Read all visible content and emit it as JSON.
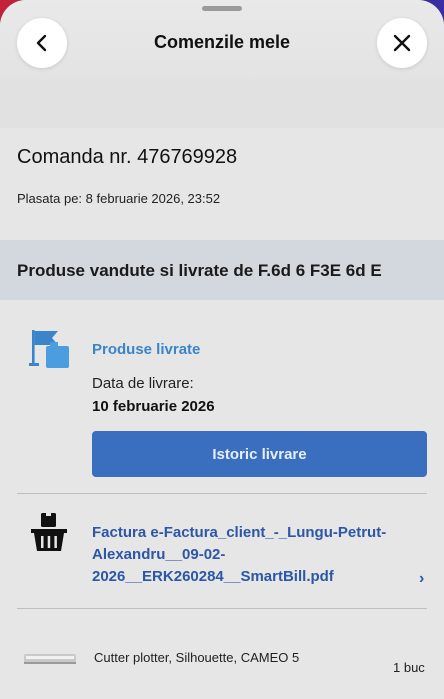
{
  "header": {
    "title": "Comenzile mele",
    "back_icon": "chevron-left-icon",
    "close_icon": "close-icon"
  },
  "order": {
    "number_text": "Comanda nr. 476769928",
    "placed_text": "Plasata pe: 8 februarie 2026, 23:52"
  },
  "seller_section": {
    "heading": "Produse vandute si livrate de F.6d 6 F3E 6d E"
  },
  "delivery": {
    "status": "Produse livrate",
    "date_label": "Data de livrare:",
    "date": "10 februarie 2026",
    "history_button": "Istoric livrare"
  },
  "invoice": {
    "link_text": "Factura e-Factura_client_-_Lungu-Petrut-Alexandru__09-02-2026__ERK260284__SmartBill.pdf",
    "chevron": "›"
  },
  "product": {
    "name": "Cutter plotter, Silhouette, CAMEO 5",
    "quantity": "1 buc"
  },
  "colors": {
    "accent_blue": "#3a6fbf",
    "status_blue": "#3a85c9",
    "link_blue": "#2c56a6",
    "seller_bar": "#d3d8df"
  }
}
